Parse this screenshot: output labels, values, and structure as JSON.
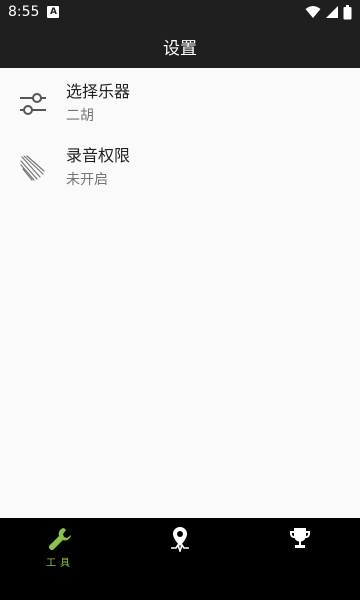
{
  "status_bar": {
    "time": "8:55",
    "notification_glyph": "A",
    "icons": [
      "wifi-icon",
      "signal-icon",
      "battery-icon"
    ]
  },
  "app_bar": {
    "title": "设置"
  },
  "settings": [
    {
      "title": "选择乐器",
      "subtitle": "二胡",
      "icon": "sliders-icon"
    },
    {
      "title": "录音权限",
      "subtitle": "未开启",
      "icon": "bow-strings-icon"
    }
  ],
  "bottom_nav": {
    "items": [
      {
        "label": "工具",
        "icon": "wrench-icon",
        "active": true
      },
      {
        "label": "",
        "icon": "tuner-pin-icon",
        "active": false
      },
      {
        "label": "",
        "icon": "trophy-icon",
        "active": false
      }
    ],
    "active_color": "#8bc34a",
    "inactive_color": "#ffffff"
  },
  "colors": {
    "bar_background": "#1f1f1f",
    "content_background": "#fafafa",
    "nav_background": "#000000"
  }
}
